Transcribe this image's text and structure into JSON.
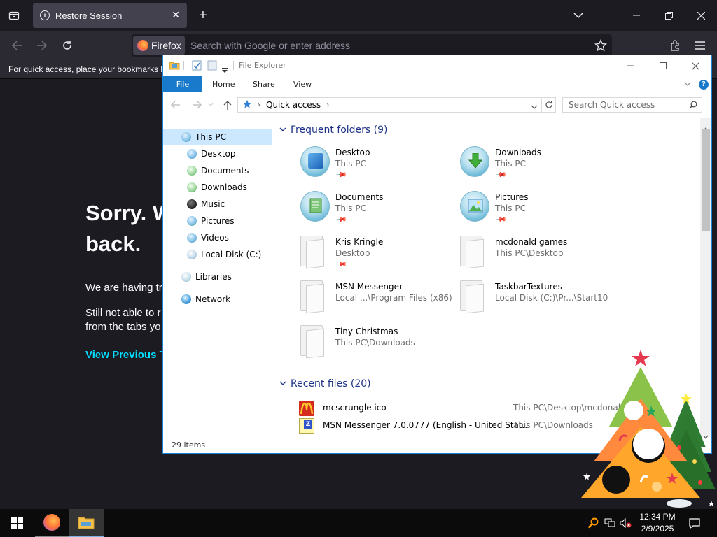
{
  "firefox": {
    "tab_title": "Restore Session",
    "identity_label": "Firefox",
    "url_placeholder": "Search with Google or enter address",
    "bookmarks_hint": "For quick access, place your bookmarks h",
    "content": {
      "sorry_line1": "Sorry. W",
      "sorry_line2": "back.",
      "trouble_text": "We are having tr",
      "still_line1": "Still not able to r",
      "still_line2": "from the tabs yo",
      "view_previous": "View Previous Ta"
    },
    "colors": {
      "background": "#1c1b22",
      "toolbar": "#2b2a33",
      "link": "#00ddff"
    }
  },
  "explorer": {
    "title": "File Explorer",
    "ribbon_tabs": [
      "File",
      "Home",
      "Share",
      "View"
    ],
    "address": {
      "location": "Quick access"
    },
    "search_placeholder": "Search Quick access",
    "nav": [
      {
        "label": "This PC",
        "icon": "pc-icon"
      },
      {
        "label": "Desktop",
        "icon": "desktop-icon"
      },
      {
        "label": "Documents",
        "icon": "documents-icon"
      },
      {
        "label": "Downloads",
        "icon": "downloads-icon"
      },
      {
        "label": "Music",
        "icon": "music-icon"
      },
      {
        "label": "Pictures",
        "icon": "pictures-icon"
      },
      {
        "label": "Videos",
        "icon": "videos-icon"
      },
      {
        "label": "Local Disk (C:)",
        "icon": "disk-icon"
      },
      {
        "label": "Libraries",
        "icon": "libraries-icon"
      },
      {
        "label": "Network",
        "icon": "network-icon"
      }
    ],
    "frequent_header": "Frequent folders (9)",
    "frequent": [
      {
        "name": "Desktop",
        "path": "This PC",
        "pinned": true
      },
      {
        "name": "Downloads",
        "path": "This PC",
        "pinned": true
      },
      {
        "name": "Documents",
        "path": "This PC",
        "pinned": true
      },
      {
        "name": "Pictures",
        "path": "This PC",
        "pinned": true
      },
      {
        "name": "Kris Kringle",
        "path": "Desktop",
        "pinned": true
      },
      {
        "name": "mcdonald games",
        "path": "This PC\\Desktop",
        "pinned": false
      },
      {
        "name": "MSN Messenger",
        "path": "Local ...\\Program Files (x86)",
        "pinned": false
      },
      {
        "name": "TaskbarTextures",
        "path": "Local Disk (C:)\\Pr...\\Start10",
        "pinned": false
      },
      {
        "name": "Tiny Christmas",
        "path": "This PC\\Downloads",
        "pinned": false
      }
    ],
    "recent_header": "Recent files (20)",
    "recent": [
      {
        "name": "mcscrungle.ico",
        "location": "This PC\\Desktop\\mcdonald games"
      },
      {
        "name": "MSN Messenger 7.0.0777 (English - United Stat...",
        "location": "This PC\\Downloads"
      }
    ],
    "status": "29 items"
  },
  "taskbar": {
    "time": "12:34 PM",
    "date": "2/9/2025"
  }
}
